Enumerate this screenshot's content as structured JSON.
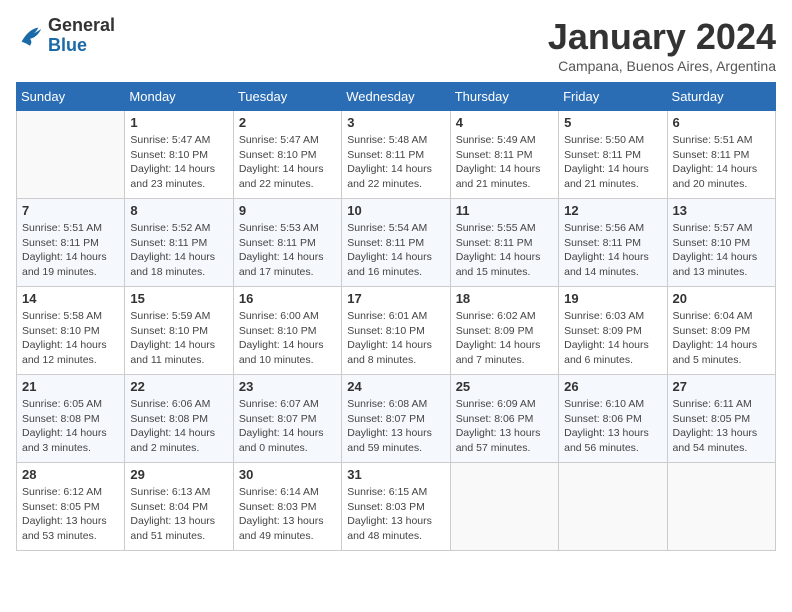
{
  "logo": {
    "general": "General",
    "blue": "Blue"
  },
  "header": {
    "title": "January 2024",
    "subtitle": "Campana, Buenos Aires, Argentina"
  },
  "weekdays": [
    "Sunday",
    "Monday",
    "Tuesday",
    "Wednesday",
    "Thursday",
    "Friday",
    "Saturday"
  ],
  "weeks": [
    [
      {
        "day": "",
        "sunrise": "",
        "sunset": "",
        "daylight": ""
      },
      {
        "day": "1",
        "sunrise": "Sunrise: 5:47 AM",
        "sunset": "Sunset: 8:10 PM",
        "daylight": "Daylight: 14 hours and 23 minutes."
      },
      {
        "day": "2",
        "sunrise": "Sunrise: 5:47 AM",
        "sunset": "Sunset: 8:10 PM",
        "daylight": "Daylight: 14 hours and 22 minutes."
      },
      {
        "day": "3",
        "sunrise": "Sunrise: 5:48 AM",
        "sunset": "Sunset: 8:11 PM",
        "daylight": "Daylight: 14 hours and 22 minutes."
      },
      {
        "day": "4",
        "sunrise": "Sunrise: 5:49 AM",
        "sunset": "Sunset: 8:11 PM",
        "daylight": "Daylight: 14 hours and 21 minutes."
      },
      {
        "day": "5",
        "sunrise": "Sunrise: 5:50 AM",
        "sunset": "Sunset: 8:11 PM",
        "daylight": "Daylight: 14 hours and 21 minutes."
      },
      {
        "day": "6",
        "sunrise": "Sunrise: 5:51 AM",
        "sunset": "Sunset: 8:11 PM",
        "daylight": "Daylight: 14 hours and 20 minutes."
      }
    ],
    [
      {
        "day": "7",
        "sunrise": "Sunrise: 5:51 AM",
        "sunset": "Sunset: 8:11 PM",
        "daylight": "Daylight: 14 hours and 19 minutes."
      },
      {
        "day": "8",
        "sunrise": "Sunrise: 5:52 AM",
        "sunset": "Sunset: 8:11 PM",
        "daylight": "Daylight: 14 hours and 18 minutes."
      },
      {
        "day": "9",
        "sunrise": "Sunrise: 5:53 AM",
        "sunset": "Sunset: 8:11 PM",
        "daylight": "Daylight: 14 hours and 17 minutes."
      },
      {
        "day": "10",
        "sunrise": "Sunrise: 5:54 AM",
        "sunset": "Sunset: 8:11 PM",
        "daylight": "Daylight: 14 hours and 16 minutes."
      },
      {
        "day": "11",
        "sunrise": "Sunrise: 5:55 AM",
        "sunset": "Sunset: 8:11 PM",
        "daylight": "Daylight: 14 hours and 15 minutes."
      },
      {
        "day": "12",
        "sunrise": "Sunrise: 5:56 AM",
        "sunset": "Sunset: 8:11 PM",
        "daylight": "Daylight: 14 hours and 14 minutes."
      },
      {
        "day": "13",
        "sunrise": "Sunrise: 5:57 AM",
        "sunset": "Sunset: 8:10 PM",
        "daylight": "Daylight: 14 hours and 13 minutes."
      }
    ],
    [
      {
        "day": "14",
        "sunrise": "Sunrise: 5:58 AM",
        "sunset": "Sunset: 8:10 PM",
        "daylight": "Daylight: 14 hours and 12 minutes."
      },
      {
        "day": "15",
        "sunrise": "Sunrise: 5:59 AM",
        "sunset": "Sunset: 8:10 PM",
        "daylight": "Daylight: 14 hours and 11 minutes."
      },
      {
        "day": "16",
        "sunrise": "Sunrise: 6:00 AM",
        "sunset": "Sunset: 8:10 PM",
        "daylight": "Daylight: 14 hours and 10 minutes."
      },
      {
        "day": "17",
        "sunrise": "Sunrise: 6:01 AM",
        "sunset": "Sunset: 8:10 PM",
        "daylight": "Daylight: 14 hours and 8 minutes."
      },
      {
        "day": "18",
        "sunrise": "Sunrise: 6:02 AM",
        "sunset": "Sunset: 8:09 PM",
        "daylight": "Daylight: 14 hours and 7 minutes."
      },
      {
        "day": "19",
        "sunrise": "Sunrise: 6:03 AM",
        "sunset": "Sunset: 8:09 PM",
        "daylight": "Daylight: 14 hours and 6 minutes."
      },
      {
        "day": "20",
        "sunrise": "Sunrise: 6:04 AM",
        "sunset": "Sunset: 8:09 PM",
        "daylight": "Daylight: 14 hours and 5 minutes."
      }
    ],
    [
      {
        "day": "21",
        "sunrise": "Sunrise: 6:05 AM",
        "sunset": "Sunset: 8:08 PM",
        "daylight": "Daylight: 14 hours and 3 minutes."
      },
      {
        "day": "22",
        "sunrise": "Sunrise: 6:06 AM",
        "sunset": "Sunset: 8:08 PM",
        "daylight": "Daylight: 14 hours and 2 minutes."
      },
      {
        "day": "23",
        "sunrise": "Sunrise: 6:07 AM",
        "sunset": "Sunset: 8:07 PM",
        "daylight": "Daylight: 14 hours and 0 minutes."
      },
      {
        "day": "24",
        "sunrise": "Sunrise: 6:08 AM",
        "sunset": "Sunset: 8:07 PM",
        "daylight": "Daylight: 13 hours and 59 minutes."
      },
      {
        "day": "25",
        "sunrise": "Sunrise: 6:09 AM",
        "sunset": "Sunset: 8:06 PM",
        "daylight": "Daylight: 13 hours and 57 minutes."
      },
      {
        "day": "26",
        "sunrise": "Sunrise: 6:10 AM",
        "sunset": "Sunset: 8:06 PM",
        "daylight": "Daylight: 13 hours and 56 minutes."
      },
      {
        "day": "27",
        "sunrise": "Sunrise: 6:11 AM",
        "sunset": "Sunset: 8:05 PM",
        "daylight": "Daylight: 13 hours and 54 minutes."
      }
    ],
    [
      {
        "day": "28",
        "sunrise": "Sunrise: 6:12 AM",
        "sunset": "Sunset: 8:05 PM",
        "daylight": "Daylight: 13 hours and 53 minutes."
      },
      {
        "day": "29",
        "sunrise": "Sunrise: 6:13 AM",
        "sunset": "Sunset: 8:04 PM",
        "daylight": "Daylight: 13 hours and 51 minutes."
      },
      {
        "day": "30",
        "sunrise": "Sunrise: 6:14 AM",
        "sunset": "Sunset: 8:03 PM",
        "daylight": "Daylight: 13 hours and 49 minutes."
      },
      {
        "day": "31",
        "sunrise": "Sunrise: 6:15 AM",
        "sunset": "Sunset: 8:03 PM",
        "daylight": "Daylight: 13 hours and 48 minutes."
      },
      {
        "day": "",
        "sunrise": "",
        "sunset": "",
        "daylight": ""
      },
      {
        "day": "",
        "sunrise": "",
        "sunset": "",
        "daylight": ""
      },
      {
        "day": "",
        "sunrise": "",
        "sunset": "",
        "daylight": ""
      }
    ]
  ]
}
